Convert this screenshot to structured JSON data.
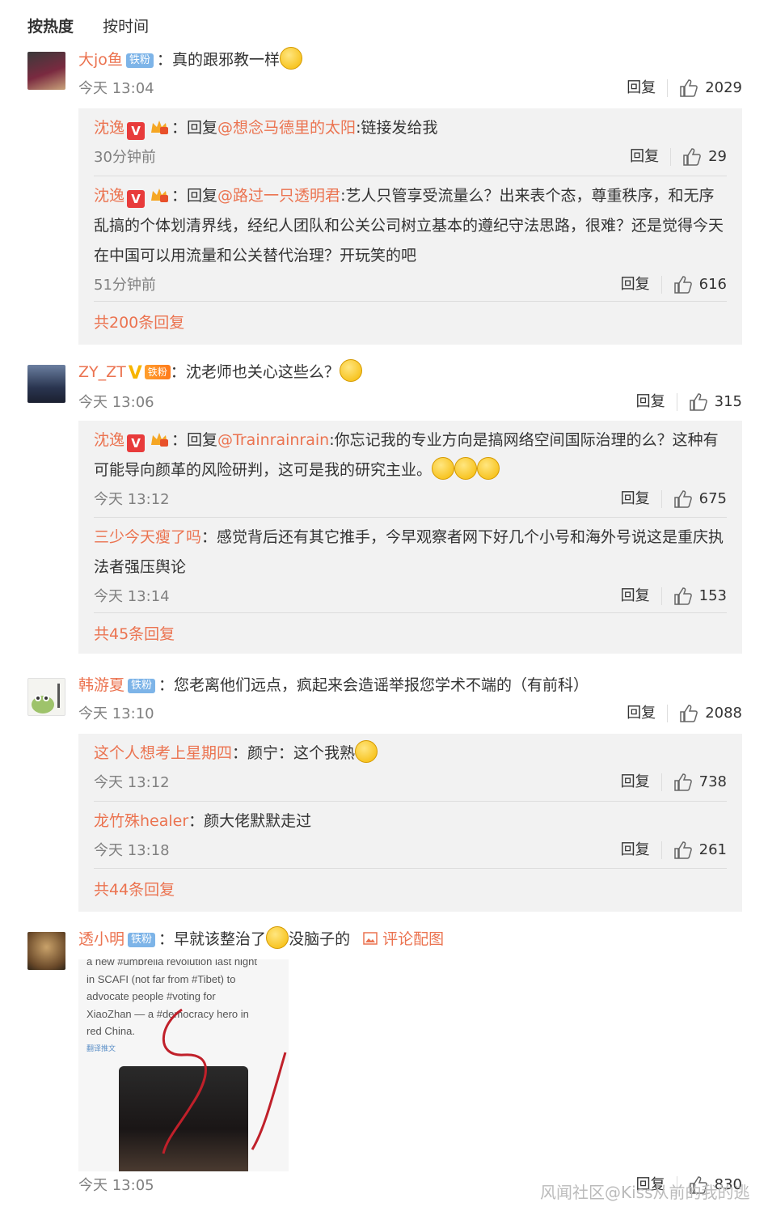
{
  "sort": {
    "hot": "按热度",
    "time": "按时间"
  },
  "labels": {
    "reply": "回复",
    "reply_prefix": "回复",
    "colon": "："
  },
  "comments": [
    {
      "user": "大jo鱼",
      "fan_badge": "铁粉",
      "text": "真的跟邪教一样",
      "time": "今天 13:04",
      "likes": "2029",
      "replies": [
        {
          "user": "沈逸",
          "mention": "@想念马德里的太阳",
          "text": ":链接发给我",
          "time": "30分钟前",
          "likes": "29"
        },
        {
          "user": "沈逸",
          "mention": "@路过一只透明君",
          "text": ":艺人只管享受流量么？出来表个态，尊重秩序，和无序乱搞的个体划清界线，经纪人团队和公关公司树立基本的遵纪守法思路，很难？还是觉得今天在中国可以用流量和公关替代治理？开玩笑的吧",
          "time": "51分钟前",
          "likes": "616"
        }
      ],
      "more": "共200条回复"
    },
    {
      "user": "ZY_ZT",
      "fan_badge": "铁粉",
      "text": "沈老师也关心这些么？",
      "time": "今天 13:06",
      "likes": "315",
      "replies": [
        {
          "user": "沈逸",
          "mention": "@Trainrainrain",
          "text": ":你忘记我的专业方向是搞网络空间国际治理的么？这种有可能导向颜革的风险研判，这可是我的研究主业。",
          "time": "今天 13:12",
          "likes": "675"
        },
        {
          "user": "三少今天瘦了吗",
          "text": "感觉背后还有其它推手，今早观察者网下好几个小号和海外号说这是重庆执法者强压舆论",
          "time": "今天 13:14",
          "likes": "153"
        }
      ],
      "more": "共45条回复"
    },
    {
      "user": "韩游夏",
      "fan_badge": "铁粉",
      "text": "您老离他们远点，疯起来会造谣举报您学术不端的（有前科）",
      "time": "今天 13:10",
      "likes": "2088",
      "replies": [
        {
          "user": "这个人想考上星期四",
          "text": "颜宁：这个我熟",
          "time": "今天 13:12",
          "likes": "738"
        },
        {
          "user": "龙竹殊healer",
          "text": "颜大佬默默走过",
          "time": "今天 13:18",
          "likes": "261"
        }
      ],
      "more": "共44条回复"
    },
    {
      "user": "透小明",
      "fan_badge": "铁粉",
      "text": "早就该整治了",
      "text2": "没脑子的",
      "pic_link": "评论配图",
      "time": "今天 13:05",
      "likes": "830",
      "image_text": [
        "a new #umbrella revolution last night",
        "in SCAFI (not far from #Tibet) to",
        "advocate people #voting for",
        "XiaoZhan — a #democracy hero in",
        "red China.",
        "翻译推文"
      ]
    }
  ],
  "watermark": "风闻社区@Kiss从前的我的逃"
}
